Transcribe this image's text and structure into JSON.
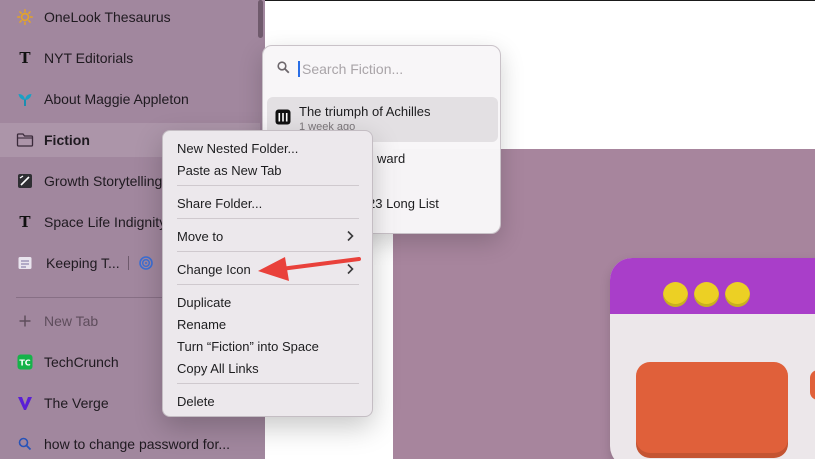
{
  "sidebar": {
    "items": [
      {
        "label": "OneLook Thesaurus",
        "icon": "sun-icon"
      },
      {
        "label": "NYT Editorials",
        "icon": "nyt-icon"
      },
      {
        "label": "About Maggie Appleton",
        "icon": "plant-icon"
      },
      {
        "label": "Fiction",
        "icon": "folder-icon"
      },
      {
        "label": "Growth Storytelling",
        "icon": "growth-icon"
      },
      {
        "label": "Space Life Indignity",
        "icon": "nyt-icon"
      },
      {
        "label": "Keeping T...",
        "icon": "doc-icon"
      },
      {
        "label": "New Tab",
        "icon": "plus-icon"
      },
      {
        "label": "TechCrunch",
        "icon": "techcrunch-icon"
      },
      {
        "label": "The Verge",
        "icon": "verge-icon"
      },
      {
        "label": "how to change password for...",
        "icon": "search-icon"
      }
    ]
  },
  "popover": {
    "search_placeholder": "Search Fiction...",
    "items": [
      {
        "title": "The triumph of Achilles",
        "sub": "1 week ago"
      },
      {
        "title": "ward",
        "sub": ""
      },
      {
        "title": "23 Long List",
        "sub": ""
      }
    ]
  },
  "context_menu": {
    "items": [
      "New Nested Folder...",
      "Paste as New Tab",
      "Share Folder...",
      "Move to",
      "Change Icon",
      "Duplicate",
      "Rename",
      "Turn “Fiction” into Space",
      "Copy All Links",
      "Delete"
    ]
  },
  "colors": {
    "sidebar_bg": "#a1879e",
    "accent_arrow": "#e9413b",
    "window_bar": "#a93ec9",
    "dots": "#ecd024",
    "orange": "#e0603a"
  }
}
